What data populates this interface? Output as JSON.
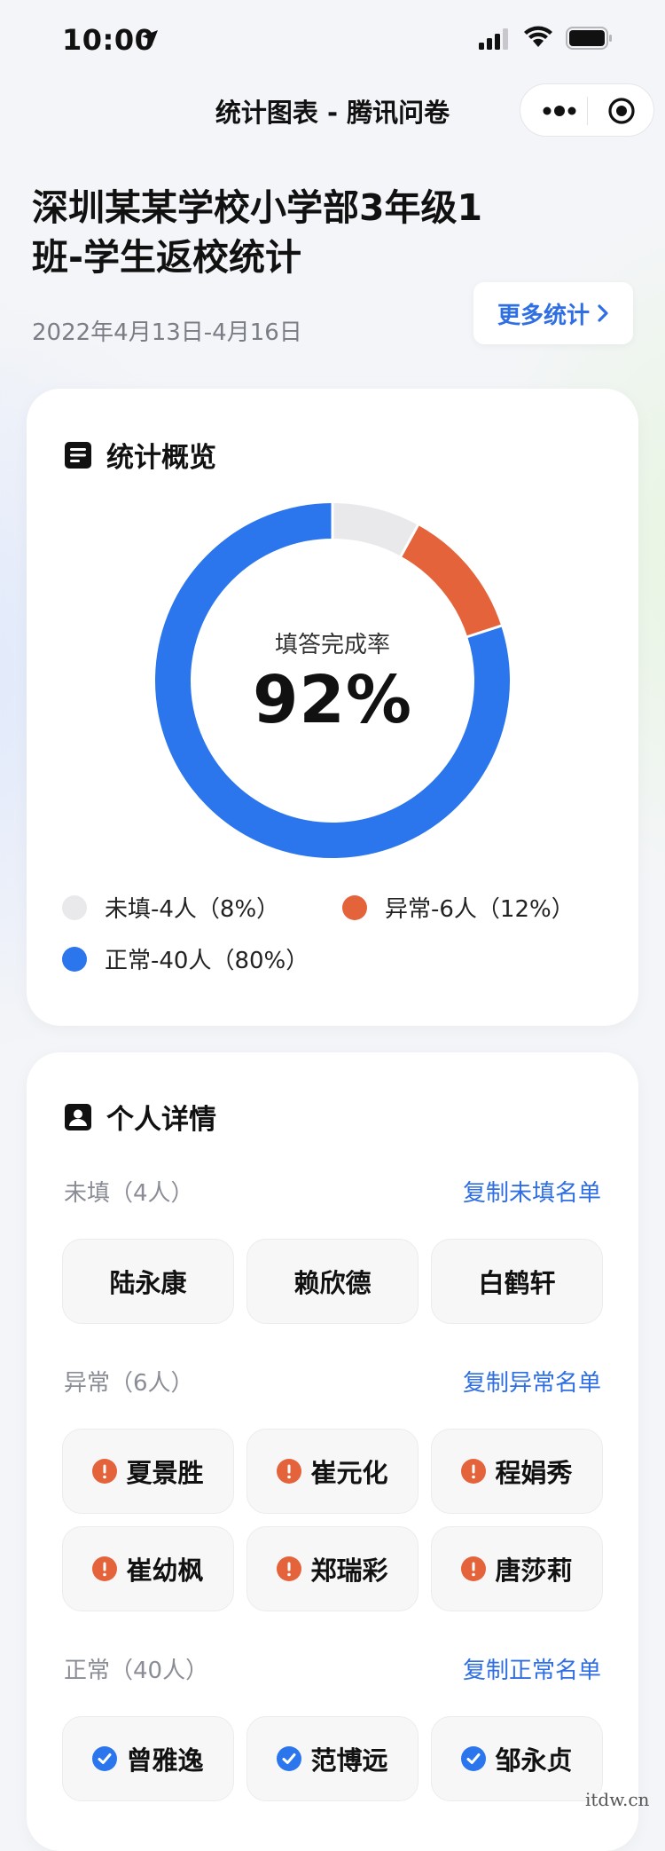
{
  "status_bar": {
    "time": "10:00"
  },
  "nav": {
    "title": "统计图表 - 腾讯问卷"
  },
  "header": {
    "title": "深圳某某学校小学部3年级1班-学生返校统计",
    "date_range": "2022年4月13日-4月16日",
    "more_stats_label": "更多统计"
  },
  "overview": {
    "title": "统计概览",
    "center_label": "填答完成率",
    "center_value": "92%",
    "legend": [
      {
        "label": "未填-4人（8%）",
        "color": "#e9e9ec"
      },
      {
        "label": "异常-6人（12%）",
        "color": "#e5633a"
      },
      {
        "label": "正常-40人（80%）",
        "color": "#2b76ec"
      }
    ]
  },
  "chart_data": {
    "type": "pie",
    "categories": [
      "未填",
      "异常",
      "正常"
    ],
    "values": [
      4,
      6,
      40
    ],
    "percent": [
      8,
      12,
      80
    ],
    "colors": [
      "#e9e9ec",
      "#e5633a",
      "#2b76ec"
    ],
    "center_label": "填答完成率",
    "center_value": "92%"
  },
  "details": {
    "title": "个人详情",
    "sections": [
      {
        "label": "未填（4人）",
        "copy": "复制未填名单",
        "status": "unfilled",
        "names": [
          "陆永康",
          "赖欣德",
          "白鹤轩"
        ]
      },
      {
        "label": "异常（6人）",
        "copy": "复制异常名单",
        "status": "abnormal",
        "names": [
          "夏景胜",
          "崔元化",
          "程娟秀",
          "崔幼枫",
          "郑瑞彩",
          "唐莎莉"
        ]
      },
      {
        "label": "正常（40人）",
        "copy": "复制正常名单",
        "status": "normal",
        "names": [
          "曾雅逸",
          "范博远",
          "邹永贞"
        ]
      }
    ]
  },
  "watermark": "itdw.cn"
}
